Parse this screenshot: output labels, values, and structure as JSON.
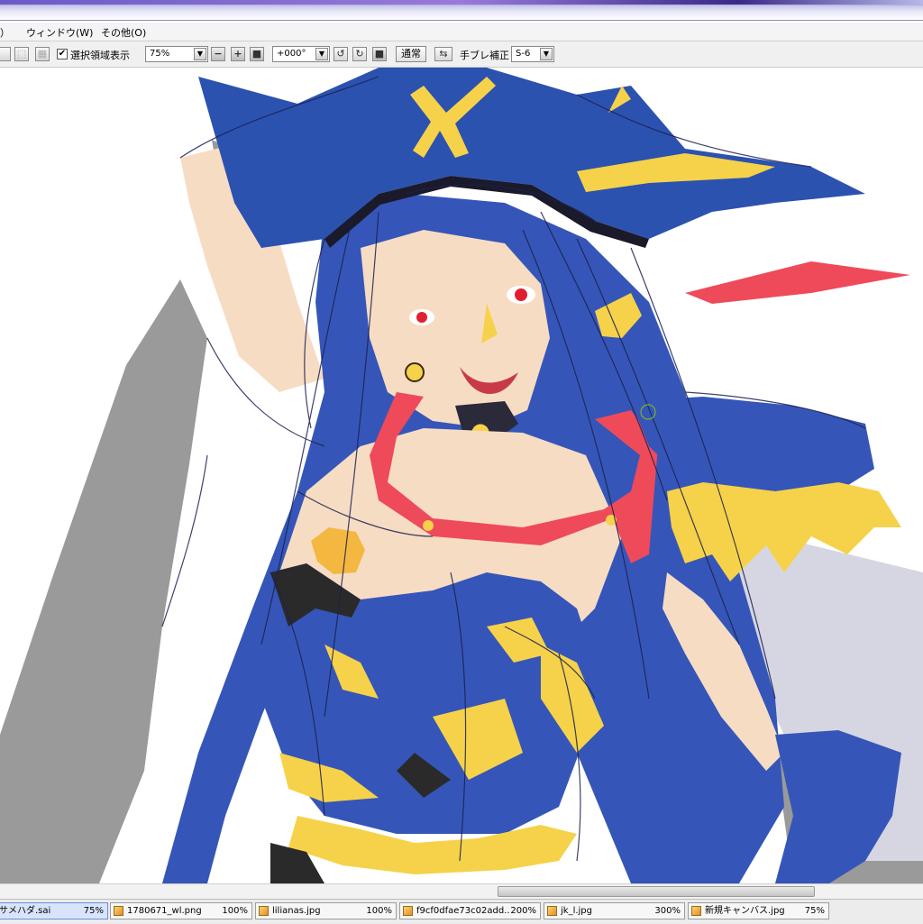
{
  "menu": {
    "items": [
      "）",
      "ウィンドウ(W)",
      "その他(O)"
    ]
  },
  "toolbar": {
    "selection_toggle_label": "選択領域表示",
    "selection_checked": "✔",
    "zoom": "75%",
    "rotation": "+000°",
    "blend_mode": "通常",
    "stabilizer_label": "手ブレ補正",
    "stabilizer_value": "S-6"
  },
  "file_tabs": [
    {
      "name": "サメハダ.sai",
      "zoom": "75%",
      "active": true
    },
    {
      "name": "1780671_wl.png",
      "zoom": "100%",
      "active": false
    },
    {
      "name": "lilianas.jpg",
      "zoom": "100%",
      "active": false
    },
    {
      "name": "f9cf0dfae73c02add...",
      "zoom": "200%",
      "active": false
    },
    {
      "name": "jk_l.jpg",
      "zoom": "300%",
      "active": false
    },
    {
      "name": "新規キャンバス.jpg",
      "zoom": "75%",
      "active": false
    }
  ],
  "colors": {
    "hair_blue": "#3556b8",
    "accent_yellow": "#f6d24a",
    "accent_red": "#ee4a5a",
    "skin": "#f7dcc4",
    "shadow_gray": "#9a9a9a"
  }
}
